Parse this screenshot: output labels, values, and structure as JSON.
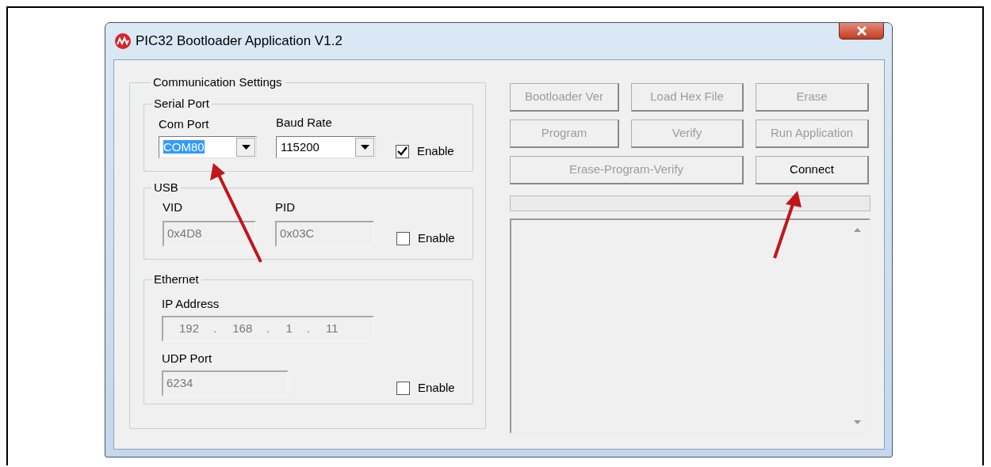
{
  "window": {
    "title": "PIC32 Bootloader Application V1.2"
  },
  "communication_settings": {
    "title": "Communication Settings",
    "serial_port": {
      "title": "Serial Port",
      "com_port": {
        "label": "Com Port",
        "value": "COM80",
        "highlighted": true,
        "disabled": false
      },
      "baud_rate": {
        "label": "Baud Rate",
        "value": "115200",
        "highlighted": false,
        "disabled": false
      },
      "enable": {
        "label": "Enable",
        "checked": true
      }
    },
    "usb": {
      "title": "USB",
      "vid": {
        "label": "VID",
        "value": "0x4D8",
        "disabled": true
      },
      "pid": {
        "label": "PID",
        "value": "0x03C",
        "disabled": true
      },
      "enable": {
        "label": "Enable",
        "checked": false
      }
    },
    "ethernet": {
      "title": "Ethernet",
      "ip_address": {
        "label": "IP Address",
        "parts": [
          "192",
          ".",
          "168",
          ".",
          "1",
          ".",
          "11"
        ],
        "disabled": true
      },
      "udp_port": {
        "label": "UDP Port",
        "value": "6234",
        "disabled": true
      },
      "enable": {
        "label": "Enable",
        "checked": false
      }
    }
  },
  "buttons": [
    {
      "label": "Bootloader Ver",
      "disabled": true,
      "wide": false
    },
    {
      "label": "Load Hex File",
      "disabled": true,
      "wide": false
    },
    {
      "label": "Erase",
      "disabled": true,
      "wide": false
    },
    {
      "label": "Program",
      "disabled": true,
      "wide": false
    },
    {
      "label": "Verify",
      "disabled": true,
      "wide": false
    },
    {
      "label": "Run Application",
      "disabled": true,
      "wide": false
    },
    {
      "label": "Erase-Program-Verify",
      "disabled": true,
      "wide": true
    },
    {
      "label": "Connect",
      "disabled": false,
      "wide": false
    }
  ]
}
